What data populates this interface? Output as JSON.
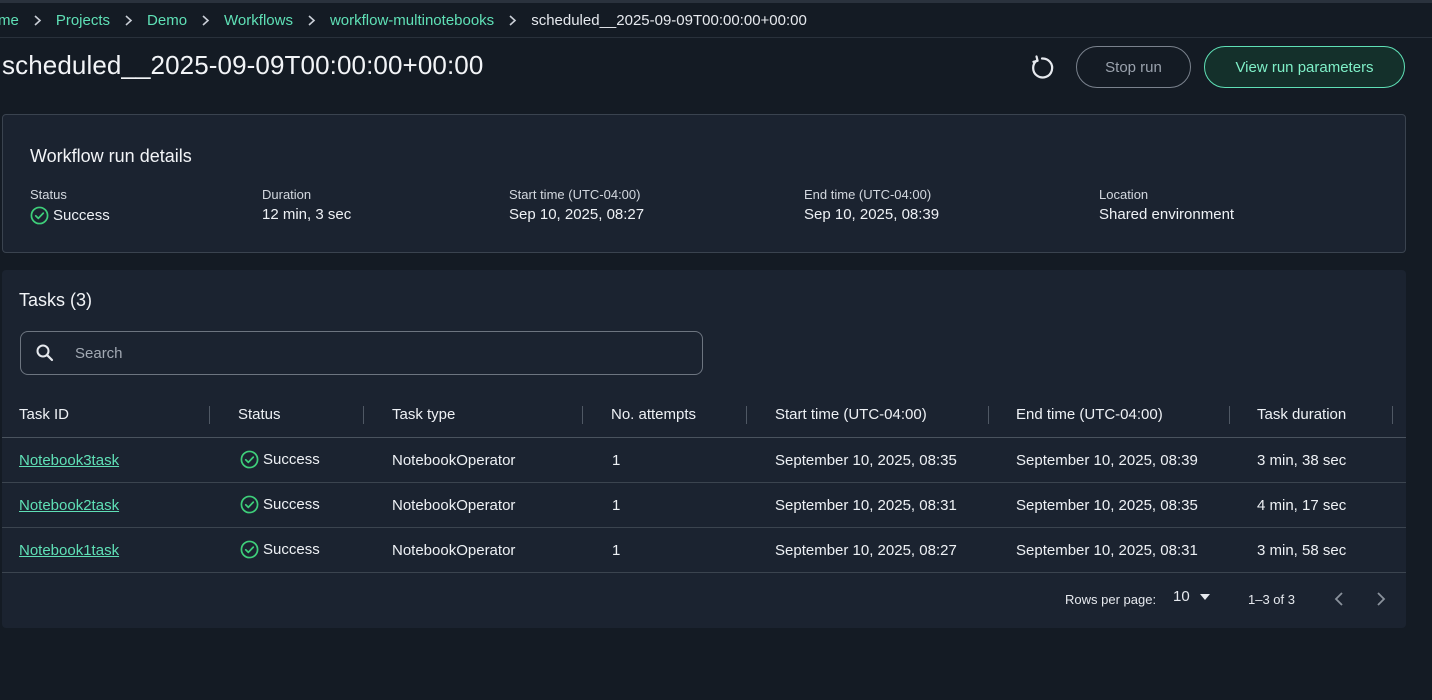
{
  "breadcrumb": {
    "items": [
      "me",
      "Projects",
      "Demo",
      "Workflows",
      "workflow-multinotebooks"
    ],
    "current": "scheduled__2025-09-09T00:00:00+00:00"
  },
  "page": {
    "title": "scheduled__2025-09-09T00:00:00+00:00",
    "stop_label": "Stop run",
    "params_label": "View run parameters"
  },
  "details": {
    "title": "Workflow run details",
    "status_label": "Status",
    "status_value": "Success",
    "duration_label": "Duration",
    "duration_value": "12 min, 3 sec",
    "start_label": "Start time (UTC-04:00)",
    "start_value": "Sep 10, 2025, 08:27",
    "end_label": "End time (UTC-04:00)",
    "end_value": "Sep 10, 2025, 08:39",
    "location_label": "Location",
    "location_value": "Shared environment"
  },
  "tasks": {
    "title": "Tasks (3)",
    "search_placeholder": "Search",
    "columns": [
      "Task ID",
      "Status",
      "Task type",
      "No. attempts",
      "Start time (UTC-04:00)",
      "End time (UTC-04:00)",
      "Task duration"
    ],
    "rows": [
      [
        "Notebook3task",
        "Success",
        "NotebookOperator",
        "1",
        "September 10, 2025, 08:35",
        "September 10, 2025, 08:39",
        "3 min, 38 sec"
      ],
      [
        "Notebook2task",
        "Success",
        "NotebookOperator",
        "1",
        "September 10, 2025, 08:31",
        "September 10, 2025, 08:35",
        "4 min, 17 sec"
      ],
      [
        "Notebook1task",
        "Success",
        "NotebookOperator",
        "1",
        "September 10, 2025, 08:27",
        "September 10, 2025, 08:31",
        "3 min, 58 sec"
      ]
    ],
    "rows_per_page_label": "Rows per page:",
    "rows_per_page_value": "10",
    "range": "1–3 of 3"
  },
  "colors": {
    "accent": "#5fe0b6",
    "background": "#141b24",
    "card": "#1b2330",
    "success": "#3ecf7a"
  },
  "icons": [
    "chevron-right-icon",
    "refresh-icon",
    "check-circle-icon",
    "search-icon",
    "caret-down-icon",
    "chevron-left-icon"
  ]
}
